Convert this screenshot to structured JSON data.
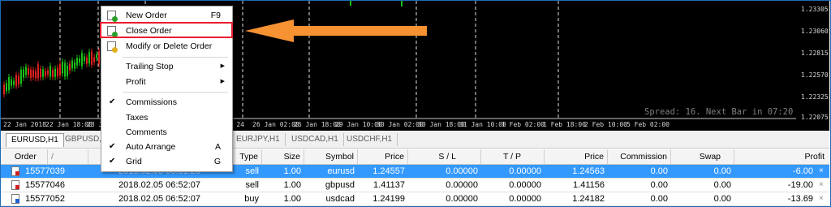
{
  "chart": {
    "price_labels": [
      "1.23305",
      "1.23060",
      "1.22815",
      "1.22570",
      "1.22325",
      "1.22075"
    ],
    "time_labels": [
      "22 Jan 2018",
      "22 Jan 18:00",
      "23 Jan",
      "24 Jan 10:00",
      "26 Jan 02:00",
      "26 Jan 18:00",
      "29 Jan 10:00",
      "30 Jan 02:00",
      "30 Jan 18:00",
      "31 Jan 10:00",
      "1 Feb 02:00",
      "1 Feb 18:00",
      "2 Feb 10:00",
      "5 Feb 02:00"
    ],
    "spread_text": "Spread: 16. Next Bar in 07:20"
  },
  "chart_tabs": [
    "EURUSD,H1",
    "GBPUSD,H1",
    "EURJPY,H1",
    "USDCAD,H1",
    "USDCHF,H1"
  ],
  "context_menu": {
    "items": [
      {
        "label": "New Order",
        "shortcut": "F9"
      },
      {
        "label": "Close Order"
      },
      {
        "label": "Modify or Delete Order"
      },
      {
        "label": "Trailing Stop"
      },
      {
        "label": "Profit"
      },
      {
        "label": "Commissions"
      },
      {
        "label": "Taxes"
      },
      {
        "label": "Comments"
      },
      {
        "label": "Auto Arrange",
        "shortcut": "A"
      },
      {
        "label": "Grid",
        "shortcut": "G"
      }
    ],
    "check_mark": "✔",
    "submenu_arrow": "▶"
  },
  "table": {
    "columns": [
      "Order",
      "/",
      "Type",
      "Size",
      "Symbol",
      "Price",
      "S / L",
      "T / P",
      "Price",
      "Commission",
      "Swap",
      "Profit"
    ],
    "rows": [
      {
        "order": "15577039",
        "time": "2018.02.05 06:51:20",
        "type": "sell",
        "size": "1.00",
        "symbol": "eurusd",
        "price": "1.24557",
        "sl": "0.00000",
        "tp": "0.00000",
        "cur_price": "1.24563",
        "commission": "0.00",
        "swap": "0.00",
        "profit": "-6.00"
      },
      {
        "order": "15577046",
        "time": "2018.02.05 06:52:07",
        "type": "sell",
        "size": "1.00",
        "symbol": "gbpusd",
        "price": "1.41137",
        "sl": "0.00000",
        "tp": "0.00000",
        "cur_price": "1.41156",
        "commission": "0.00",
        "swap": "0.00",
        "profit": "-19.00"
      },
      {
        "order": "15577052",
        "time": "2018.02.05 06:52:07",
        "type": "buy",
        "size": "1.00",
        "symbol": "usdcad",
        "price": "1.24199",
        "sl": "0.00000",
        "tp": "0.00000",
        "cur_price": "1.24182",
        "commission": "0.00",
        "swap": "0.00",
        "profit": "-13.69"
      }
    ],
    "close_glyph": "×"
  },
  "colors": {
    "highlight": "#e81c2c",
    "arrow": "#f79232",
    "selected_row": "#3399ff",
    "bull_candle": "#18c018",
    "bear_candle": "#e02020"
  }
}
